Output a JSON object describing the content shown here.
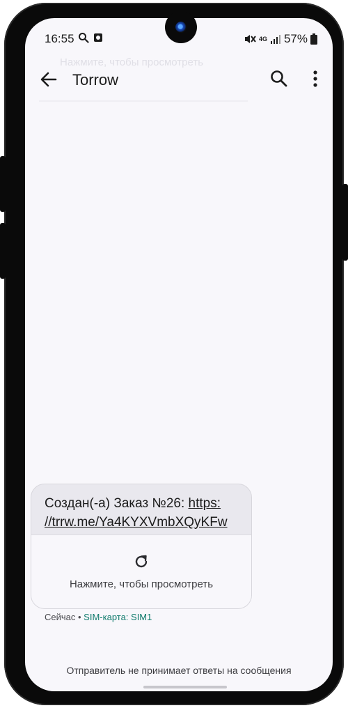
{
  "status_bar": {
    "time": "16:55",
    "network": "4G",
    "battery": "57%"
  },
  "background_ghost_text": "Нажмите, чтобы просмотреть",
  "app_bar": {
    "title": "Torrow"
  },
  "message": {
    "text_prefix": "Создан(-а) Заказ №26: ",
    "link": "https://trrw.me/Ya4KYXVmbXQyKFw",
    "link_display": "https: //trrw.me/Ya4KYXVmbXQyKFw",
    "preview_label": "Нажмите, чтобы просмотреть",
    "time": "Сейчас",
    "separator": " • ",
    "sim": "SIM-карта: SIM1"
  },
  "footer_note": "Отправитель не принимает ответы на сообщения",
  "colors": {
    "bubble_bg": "#e9e8ee",
    "screen_bg": "#f8f7fb",
    "sim_accent": "#0e7a6b"
  },
  "icons": [
    "search-icon",
    "photo-icon",
    "mute-icon",
    "signal-icon",
    "battery-icon",
    "back-arrow-icon",
    "more-vert-icon",
    "reload-icon"
  ]
}
